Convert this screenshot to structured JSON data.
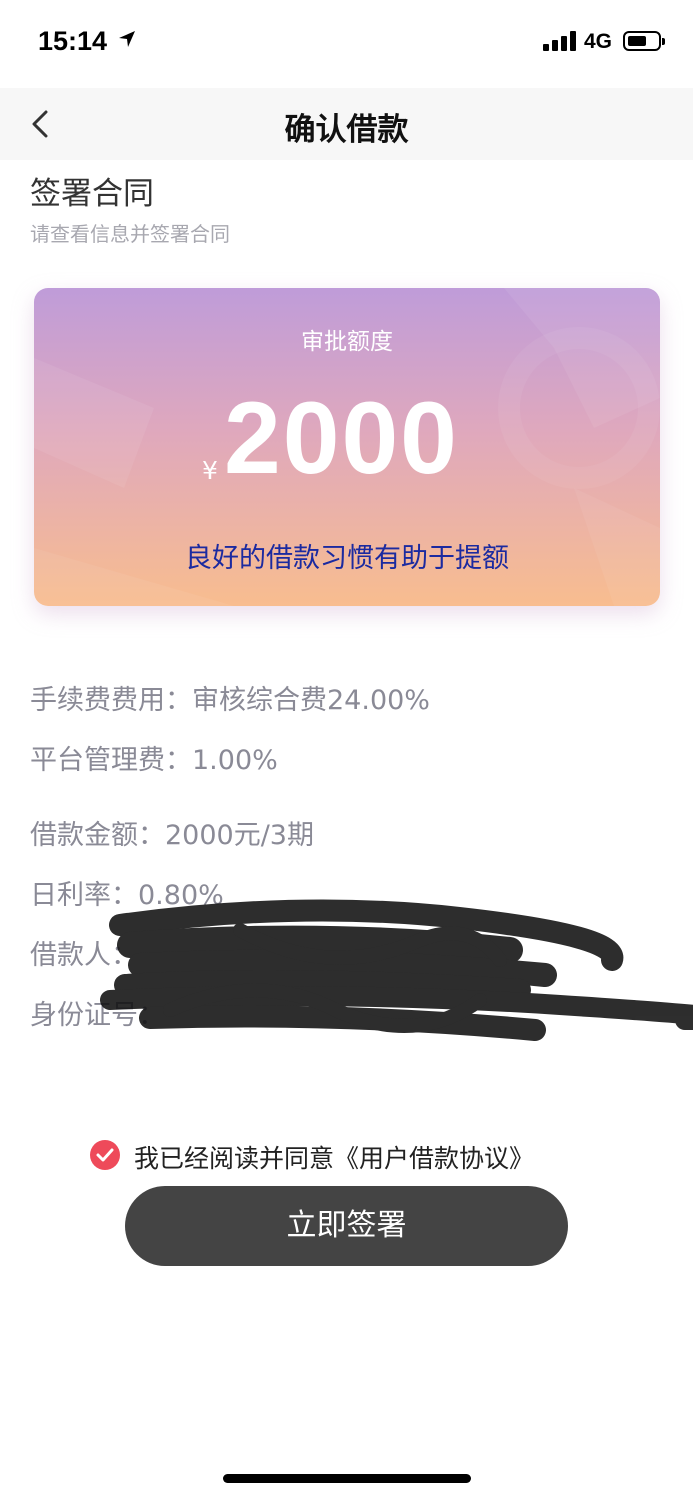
{
  "status_bar": {
    "time": "15:14",
    "network": "4G",
    "battery_level": 0.6
  },
  "nav": {
    "title": "确认借款"
  },
  "section": {
    "title": "签署合同",
    "subtitle": "请查看信息并签署合同"
  },
  "card": {
    "label": "审批额度",
    "currency": "¥",
    "amount": "2000",
    "tip": "良好的借款习惯有助于提额",
    "gradient_top": "#bf9cd9",
    "gradient_bottom": "#f8bd8f",
    "tip_color": "#1b2aa0"
  },
  "details": {
    "fee": "手续费费用：审核综合费24.00%",
    "platform_fee": "平台管理费：1.00%",
    "loan_amount": "借款金额：2000元/3期",
    "daily_rate": "日利率：0.80%",
    "borrower_label": "借款人：",
    "id_label": "身份证号："
  },
  "agreement": {
    "text": "我已经阅读并同意《用户借款协议》",
    "checked": true,
    "check_color": "#ee4a5a"
  },
  "actions": {
    "sign_label": "立即签署",
    "button_color": "#444444"
  }
}
